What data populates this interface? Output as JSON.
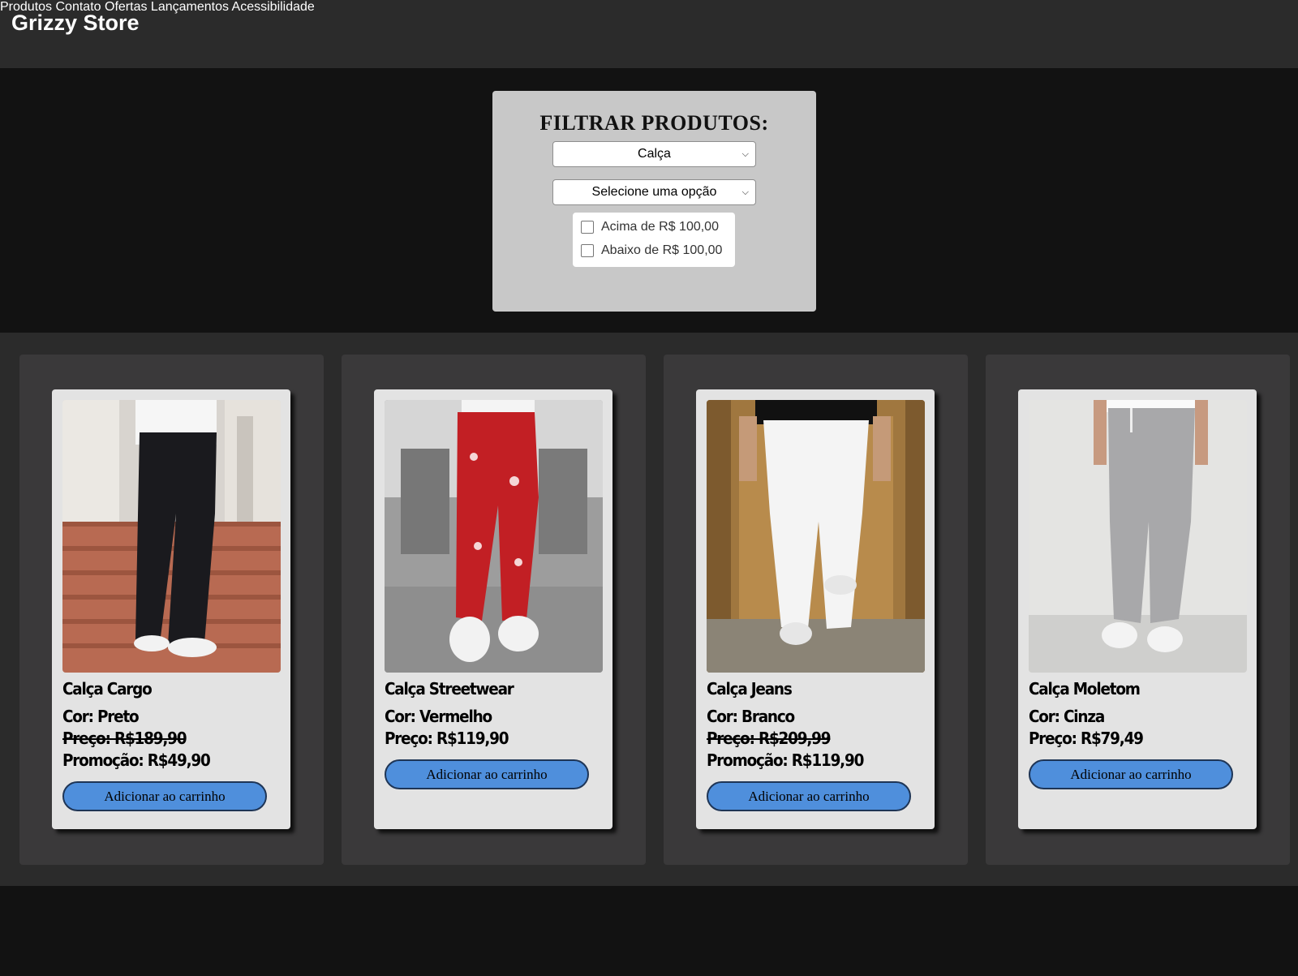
{
  "header": {
    "brand": "Grizzy Store",
    "nav": [
      "Produtos",
      "Contato",
      "Ofertas",
      "Lançamentos",
      "Acessibilidade"
    ]
  },
  "filter": {
    "title": "FILTRAR PRODUTOS:",
    "category_value": "Calça",
    "option_value": "Selecione uma opção",
    "checkboxes": [
      "Acima de R$ 100,00",
      "Abaixo de R$ 100,00"
    ]
  },
  "colors": {
    "header_bg": "#2b2b2b",
    "page_bg": "#121212",
    "button_blue": "#4f8fdc"
  },
  "products": [
    {
      "name": "Calça Cargo",
      "color": "Cor: Preto",
      "price": "Preço: R$189,90",
      "promo": "Promoção: R$49,90",
      "button": "Adicionar ao carrinho"
    },
    {
      "name": "Calça Streetwear",
      "color": "Cor: Vermelho",
      "price": "Preço: R$119,90",
      "button": "Adicionar ao carrinho"
    },
    {
      "name": "Calça Jeans",
      "color": "Cor: Branco",
      "price": "Preço: R$209,99",
      "promo": "Promoção: R$119,90",
      "button": "Adicionar ao carrinho"
    },
    {
      "name": "Calça Moletom",
      "color": "Cor: Cinza",
      "price": "Preço: R$79,49",
      "button": "Adicionar ao carrinho"
    }
  ]
}
